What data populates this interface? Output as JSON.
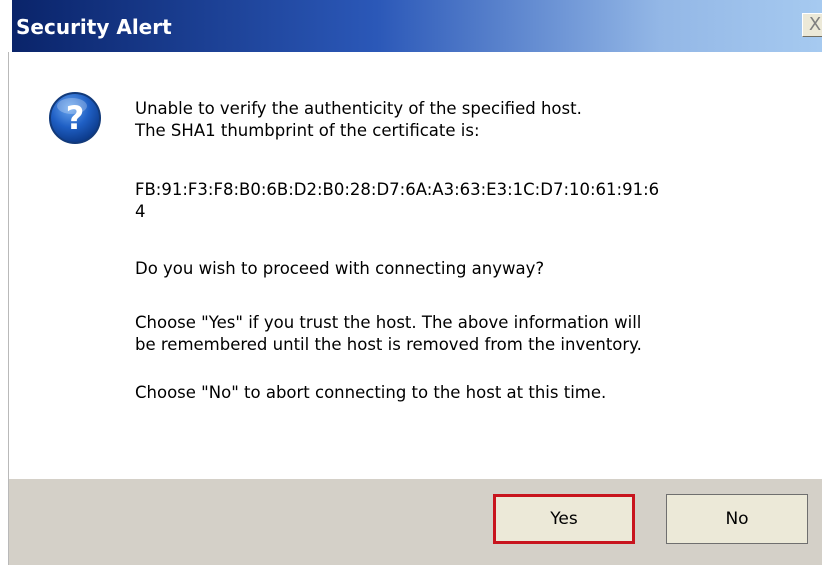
{
  "window": {
    "title": "Security Alert",
    "close_label": "X"
  },
  "message": {
    "line1": "Unable to verify the authenticity of the specified host.",
    "line2": "The SHA1 thumbprint of the certificate is:",
    "thumbprint_line1": "FB:91:F3:F8:B0:6B:D2:B0:28:D7:6A:A3:63:E3:1C:D7:10:61:91:6",
    "thumbprint_line2": "4",
    "question": "Do you wish to proceed with connecting anyway?",
    "yes_hint_line1": "Choose \"Yes\" if you trust the host. The above information will",
    "yes_hint_line2": "be remembered until the host is removed from the inventory.",
    "no_hint": "Choose \"No\" to abort connecting to the host at this time."
  },
  "buttons": {
    "yes_label": "Yes",
    "no_label": "No"
  },
  "icons": {
    "question": "question-icon",
    "close": "close-icon"
  },
  "colors": {
    "titlebar": "#0a246a",
    "focus_outline": "#c8141e",
    "footer": "#d4d0c8"
  }
}
